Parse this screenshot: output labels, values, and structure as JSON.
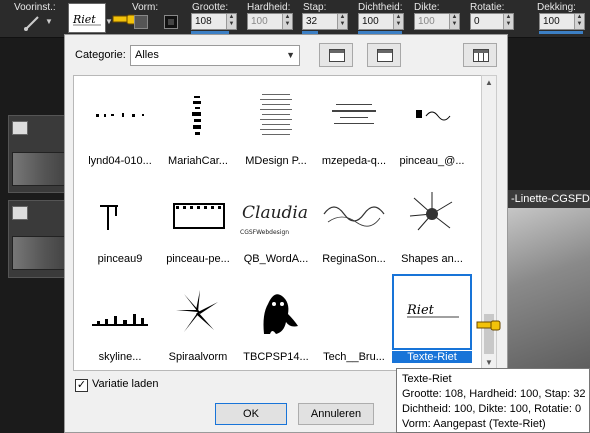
{
  "toolbar": {
    "presets_label": "Voorinst.:",
    "shape_label": "Vorm:",
    "size": {
      "label": "Grootte:",
      "value": "108"
    },
    "hardness": {
      "label": "Hardheid:",
      "value": "100"
    },
    "step": {
      "label": "Stap:",
      "value": "32"
    },
    "density": {
      "label": "Dichtheid:",
      "value": "100"
    },
    "thickness": {
      "label": "Dikte:",
      "value": "100"
    },
    "rotation": {
      "label": "Rotatie:",
      "value": "0"
    },
    "opacity": {
      "label": "Dekking:",
      "value": "100"
    }
  },
  "workspace": {
    "right_window_title": "-Linette-CGSFD"
  },
  "dialog": {
    "category_label": "Categorie:",
    "category_value": "Alles",
    "brushes": [
      {
        "name": "lynd04-010..."
      },
      {
        "name": "MariahCar..."
      },
      {
        "name": "MDesign P..."
      },
      {
        "name": "mzepeda-q..."
      },
      {
        "name": "pinceau_@..."
      },
      {
        "name": "pinceau9"
      },
      {
        "name": "pinceau-pe..."
      },
      {
        "name": "QB_WordA..."
      },
      {
        "name": "ReginaSon..."
      },
      {
        "name": "Shapes an..."
      },
      {
        "name": "skyline..."
      },
      {
        "name": "Spiraalvorm"
      },
      {
        "name": "TBCPSP14..."
      },
      {
        "name": "Tech__Bru..."
      },
      {
        "name": "Texte-Riet"
      }
    ],
    "selected_index": 14,
    "thumb_text": {
      "claudia": "Claudia",
      "claudia_sub": "CGSFWebdesign",
      "riet": "Riet"
    },
    "variation_label": "Variatie laden",
    "variation_checked": true,
    "ok_label": "OK",
    "cancel_label": "Annuleren"
  },
  "tooltip": {
    "line1": "Texte-Riet",
    "line2": "Grootte: 108, Hardheid: 100, Stap: 32",
    "line3": "Dichtheid: 100, Dikte: 100, Rotatie: 0",
    "line4": "Vorm: Aangepast (Texte-Riet)"
  }
}
